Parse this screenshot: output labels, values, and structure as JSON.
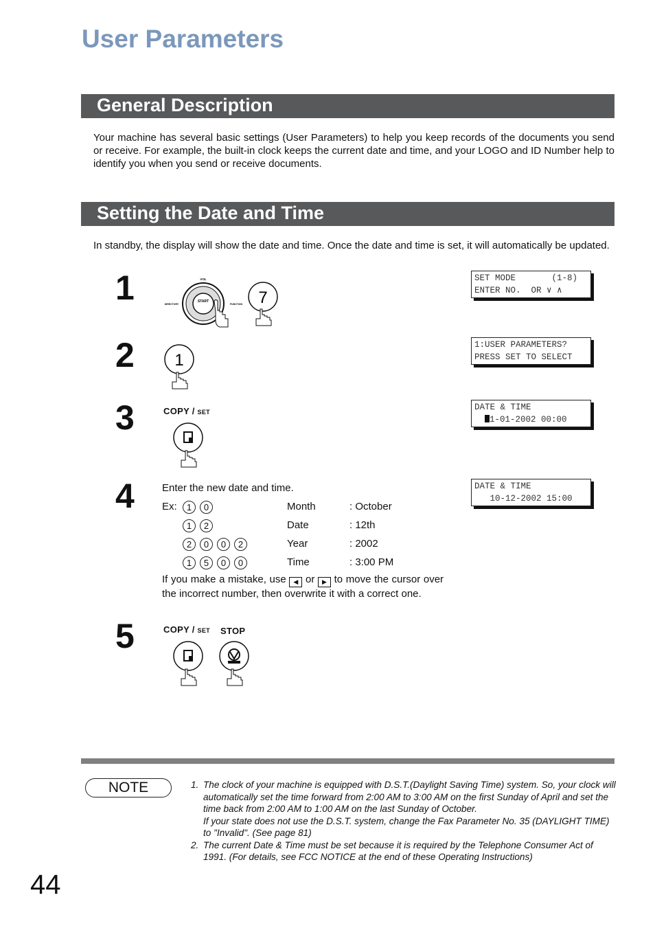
{
  "page_title": "User Parameters",
  "sections": {
    "general": "General Description",
    "date_time": "Setting the Date and Time"
  },
  "general_text": "Your machine has several basic settings (User Parameters) to help you keep records of the documents you send or receive. For example, the built-in clock keeps the current date and time, and your LOGO and ID Number help to identify you when you send or receive documents.",
  "date_intro": "In standby, the display will show the date and time.  Once the date and time is set, it will automatically be updated.",
  "steps": [
    {
      "num": "1",
      "panel_labels": {
        "vol": "VOL",
        "start": "START",
        "directory": "DIRECTORY SEARCH",
        "function": "FUNCTION"
      },
      "key": "7",
      "lcd": [
        "SET MODE       (1-8)",
        "ENTER NO.  OR ∨ ∧"
      ]
    },
    {
      "num": "2",
      "key": "1",
      "lcd": [
        "1:USER PARAMETERS?",
        "PRESS SET TO SELECT"
      ]
    },
    {
      "num": "3",
      "button_label": "COPY / ",
      "button_label_small": "SET",
      "lcd": [
        "DATE & TIME",
        "1-01-2002 00:00"
      ]
    },
    {
      "num": "4",
      "instruction": "Enter the new date and time.",
      "ex_label": "Ex:",
      "rows": [
        {
          "keys": [
            "1",
            "0"
          ],
          "field": "Month",
          "value": ": October"
        },
        {
          "keys": [
            "1",
            "2"
          ],
          "field": "Date",
          "value": ": 12th"
        },
        {
          "keys": [
            "2",
            "0",
            "0",
            "2"
          ],
          "field": "Year",
          "value": ": 2002"
        },
        {
          "keys": [
            "1",
            "5",
            "0",
            "0"
          ],
          "field": "Time",
          "value": ": 3:00 PM"
        }
      ],
      "mistake_1": "If you make a mistake, use",
      "mistake_or": "or",
      "mistake_2": "to move the cursor over the incorrect number, then overwrite it with a correct one.",
      "lcd": [
        "DATE & TIME",
        "   10-12-2002 15:00"
      ]
    },
    {
      "num": "5",
      "button_label": "COPY / ",
      "button_label_small": "SET",
      "stop_label": "STOP"
    }
  ],
  "note": {
    "label": "NOTE",
    "items": [
      {
        "n": "1.",
        "text": "The clock of your machine is equipped with D.S.T.(Daylight Saving Time) system. So, your clock will automatically set the time forward from 2:00 AM to 3:00 AM on the first Sunday of April and set the time back from 2:00 AM to 1:00 AM on the last Sunday of October.",
        "text2": "If your state does not use the D.S.T. system, change the Fax Parameter No. 35 (DAYLIGHT TIME) to \"Invalid\". (See page 81)"
      },
      {
        "n": "2.",
        "text": "The current Date & Time must be set because it is required by the Telephone Consumer Act of 1991. (For details, see FCC NOTICE at the end of these Operating Instructions)"
      }
    ]
  },
  "page_number": "44",
  "colors": {
    "title": "#7b98bb",
    "bar": "#58595b",
    "rule": "#808080"
  }
}
